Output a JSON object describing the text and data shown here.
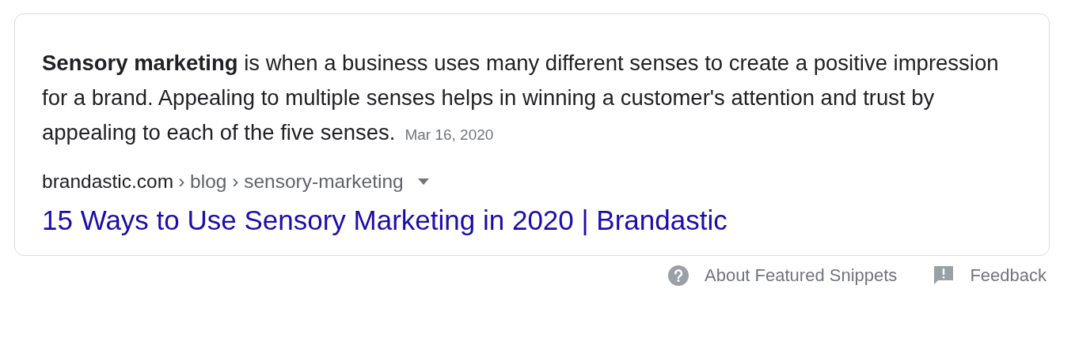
{
  "snippet": {
    "text": "**Sensory marketing** is when a business uses many different senses to create a positive impression for a brand. Appealing to multiple senses helps in winning a customer's attention and trust by appealing to each of the five senses.",
    "date": "Mar 16, 2020",
    "source": {
      "domain": "brandastic.com",
      "path": "› blog › sensory-marketing"
    },
    "link_title": "15 Ways to Use Sensory Marketing in 2020 | Brandastic"
  },
  "footer": [
    {
      "kind": "help",
      "label": "About Featured Snippets"
    },
    {
      "kind": "feedback",
      "label": "Feedback"
    }
  ]
}
